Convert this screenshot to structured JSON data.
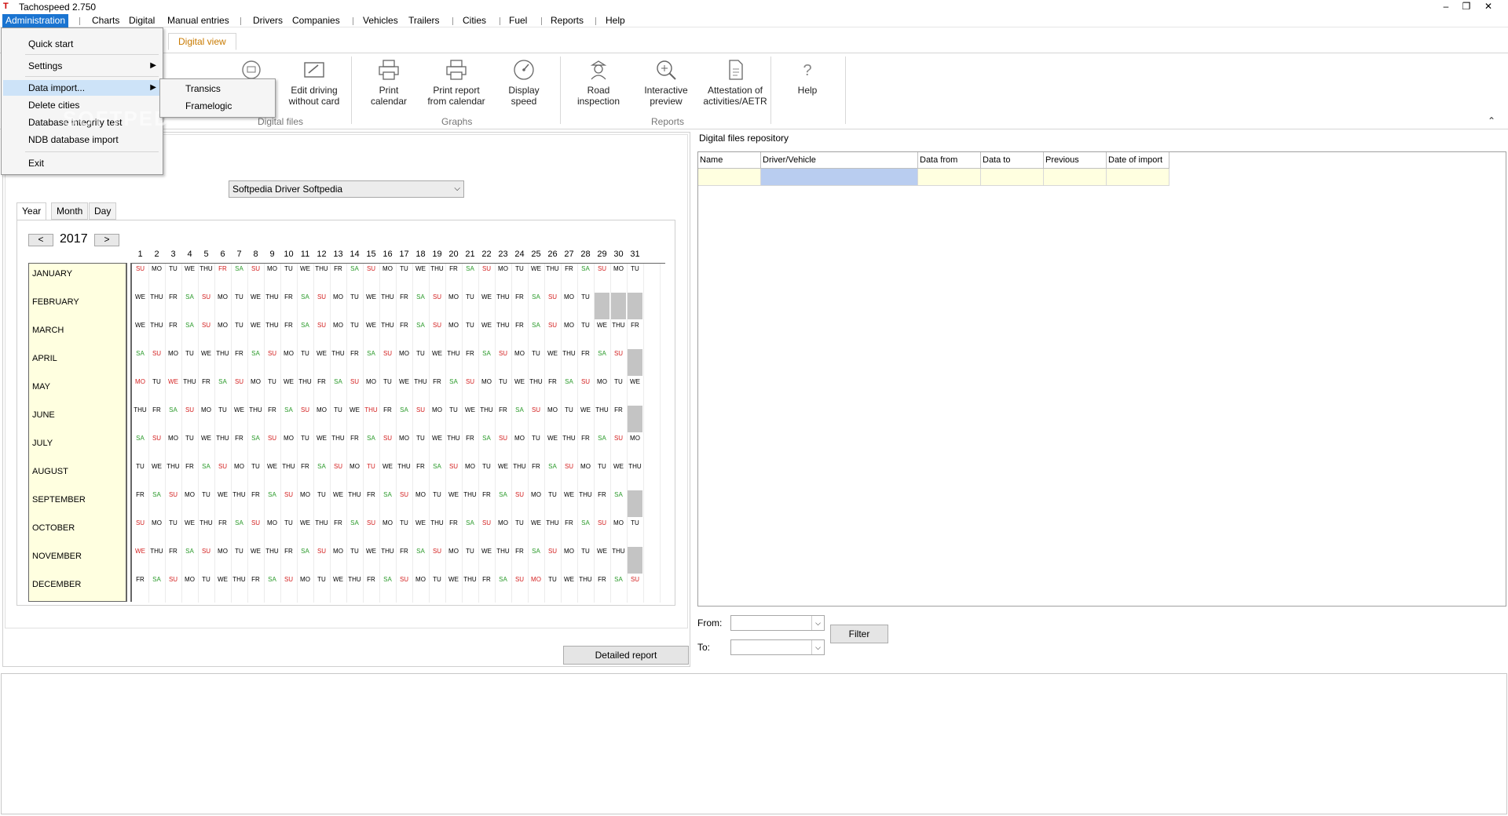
{
  "window": {
    "title": "Tachospeed 2.750",
    "minimize": "‒",
    "restore": "❐",
    "close": "✕"
  },
  "menu": {
    "items": [
      "Administration",
      "Charts",
      "Digital",
      "Manual entries",
      "Drivers",
      "Companies",
      "Vehicles",
      "Trailers",
      "Cities",
      "Fuel",
      "Reports",
      "Help"
    ]
  },
  "ribbon": {
    "active_tab": "Digital view",
    "buttons": {
      "edit_driving": "Edit driving\nwithout card",
      "print_calendar": "Print\ncalendar",
      "print_report": "Print report\nfrom calendar",
      "display_speed": "Display\nspeed",
      "road_inspection": "Road\ninspection",
      "interactive_preview": "Interactive\npreview",
      "attestation": "Attestation of\nactivities/AETR",
      "help": "Help"
    },
    "groups": {
      "digital_files": "Digital files",
      "graphs": "Graphs",
      "reports": "Reports"
    }
  },
  "admin_menu": {
    "items": [
      "Quick start",
      "Settings",
      "Data import...",
      "Delete cities",
      "Database integrity test",
      "NDB database import",
      "Exit"
    ],
    "submenu": [
      "Transics",
      "Framelogic"
    ]
  },
  "watermark": "SOFTPEDIA",
  "calendar": {
    "driver": "Softpedia Driver Softpedia",
    "tabs": [
      "Year",
      "Month",
      "Day"
    ],
    "active_tab": "Year",
    "prev": "<",
    "next": ">",
    "year": "2017",
    "months": [
      "JANUARY",
      "FEBRUARY",
      "MARCH",
      "APRIL",
      "MAY",
      "JUNE",
      "JULY",
      "AUGUST",
      "SEPTEMBER",
      "OCTOBER",
      "NOVEMBER",
      "DECEMBER"
    ],
    "day_numbers": [
      "1",
      "2",
      "3",
      "4",
      "5",
      "6",
      "7",
      "8",
      "9",
      "10",
      "11",
      "12",
      "13",
      "14",
      "15",
      "16",
      "17",
      "18",
      "19",
      "20",
      "21",
      "22",
      "23",
      "24",
      "25",
      "26",
      "27",
      "28",
      "29",
      "30",
      "31"
    ],
    "month_first_weekday": [
      6,
      2,
      2,
      5,
      0,
      3,
      5,
      1,
      4,
      6,
      2,
      4
    ],
    "month_days": [
      31,
      28,
      31,
      30,
      31,
      30,
      31,
      31,
      30,
      31,
      30,
      31
    ],
    "weekday_abbr": [
      "MO",
      "TU",
      "WE",
      "THU",
      "FR",
      "SA",
      "SU"
    ],
    "holidays": [
      [
        0,
        5
      ],
      [
        4,
        0
      ],
      [
        4,
        2
      ],
      [
        5,
        14
      ],
      [
        7,
        14
      ],
      [
        10,
        0
      ],
      [
        11,
        24
      ]
    ],
    "detailed_report": "Detailed report"
  },
  "repository": {
    "title": "Digital files repository",
    "columns": [
      "Name",
      "Driver/Vehicle",
      "Data from",
      "Data to",
      "Previous",
      "Date of import"
    ],
    "from_label": "From:",
    "to_label": "To:",
    "filter": "Filter"
  },
  "colors": {
    "accent": "#1a74d1",
    "weekend": "#2a9a2a",
    "sunday": "#d42020",
    "month_bg": "#ffffe0",
    "selected_cell": "#b9cdf0"
  }
}
